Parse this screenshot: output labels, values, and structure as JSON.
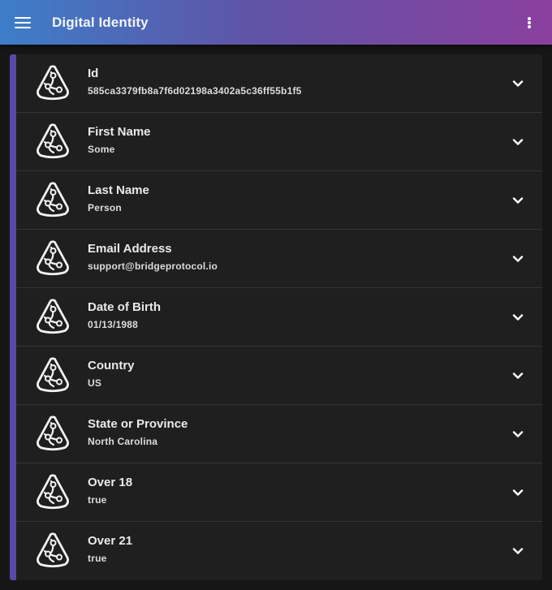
{
  "header": {
    "title": "Digital Identity",
    "menu_icon": "hamburger-menu-icon",
    "more_icon": "more-vert-icon"
  },
  "colors": {
    "header_gradient_start": "#3d7ec9",
    "header_gradient_end": "#8a3f9e",
    "card_accent": "#5949a6",
    "card_background": "#1f1f1f",
    "page_background": "#161616"
  },
  "claims": [
    {
      "label": "Id",
      "value": "585ca3379fb8a7f6d02198a3402a5c36ff55b1f5",
      "icon": "bridge-protocol-icon"
    },
    {
      "label": "First Name",
      "value": "Some",
      "icon": "bridge-protocol-icon"
    },
    {
      "label": "Last Name",
      "value": "Person",
      "icon": "bridge-protocol-icon"
    },
    {
      "label": "Email Address",
      "value": "support@bridgeprotocol.io",
      "icon": "bridge-protocol-icon"
    },
    {
      "label": "Date of Birth",
      "value": "01/13/1988",
      "icon": "bridge-protocol-icon"
    },
    {
      "label": "Country",
      "value": "US",
      "icon": "bridge-protocol-icon"
    },
    {
      "label": "State or Province",
      "value": "North Carolina",
      "icon": "bridge-protocol-icon"
    },
    {
      "label": "Over 18",
      "value": "true",
      "icon": "bridge-protocol-icon"
    },
    {
      "label": "Over 21",
      "value": "true",
      "icon": "bridge-protocol-icon"
    }
  ]
}
